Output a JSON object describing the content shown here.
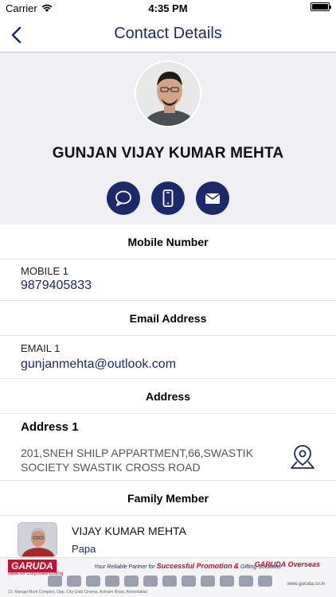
{
  "status_bar": {
    "carrier": "Carrier",
    "time": "4:35 PM"
  },
  "nav": {
    "title": "Contact Details",
    "back_icon": "chevron-left-icon"
  },
  "contact": {
    "name": "GUNJAN VIJAY KUMAR MEHTA",
    "actions": [
      {
        "icon": "chat-bubble-icon"
      },
      {
        "icon": "mobile-phone-icon"
      },
      {
        "icon": "envelope-icon"
      }
    ]
  },
  "sections": {
    "mobile_header": "Mobile Number",
    "email_header": "Email Address",
    "address_header": "Address",
    "family_header": "Family Member"
  },
  "mobile": {
    "label": "MOBILE 1",
    "value": "9879405833"
  },
  "email": {
    "label": "EMAIL 1",
    "value": "gunjanmehta@outlook.com"
  },
  "address": {
    "title": "Address 1",
    "line1": "201,SNEH SHILP APPARTMENT,66,SWASTIK",
    "line2": "SOCIETY SWASTIK CROSS ROAD",
    "icon": "map-pin-icon"
  },
  "family": [
    {
      "name": "VIJAY KUMAR MEHTA",
      "relation": "Papa"
    }
  ],
  "ad": {
    "brand": "GARUDA",
    "brand_sub": "Ideal for Corporate Gifting",
    "tagline_intro": "Your Reliable Partner for",
    "tagline_main": "Successful Promotion",
    "tagline_connector": "&",
    "tagline_end": "Gifting Solutions",
    "brand_right": "GARUDA Overseas",
    "url": "www.garuda.co.in",
    "footer": "13, Mangal Murti Complex, Opp. City Gold Cinema, Ashram Road, Ahmedabad"
  },
  "colors": {
    "accent": "#1c2a6b",
    "profile_bg": "#efeff4",
    "ad_red": "#c8102e"
  }
}
